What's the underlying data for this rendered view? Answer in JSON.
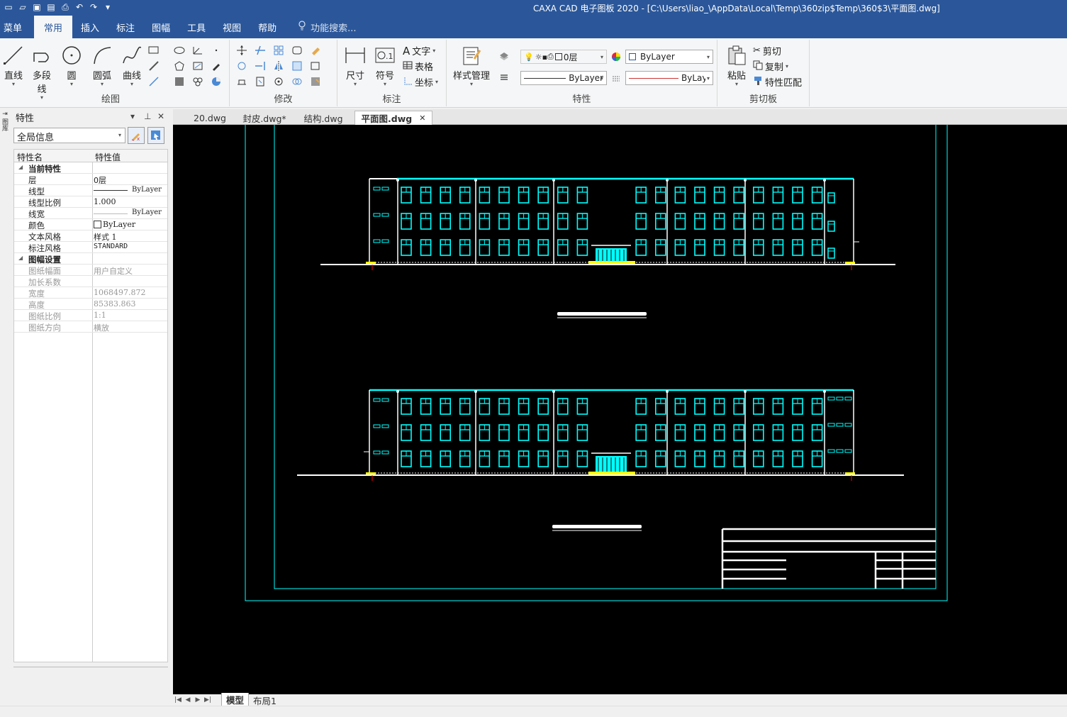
{
  "window": {
    "title": "CAXA CAD 电子图板 2020 - [C:\\Users\\liao_\\AppData\\Local\\Temp\\360zip$Temp\\360$3\\平面图.dwg]"
  },
  "ribbon": {
    "tabs": [
      {
        "label": "菜单"
      },
      {
        "label": "常用"
      },
      {
        "label": "插入"
      },
      {
        "label": "标注"
      },
      {
        "label": "图幅"
      },
      {
        "label": "工具"
      },
      {
        "label": "视图"
      },
      {
        "label": "帮助"
      }
    ],
    "active_tab": "常用",
    "search_placeholder": "功能搜索...",
    "groups": {
      "draw": {
        "label": "绘图",
        "line": "直线",
        "polyline": "多段线",
        "circle": "圆",
        "arc": "圆弧",
        "curve": "曲线"
      },
      "modify": {
        "label": "修改"
      },
      "annotate": {
        "label": "标注",
        "dimension": "尺寸",
        "symbol": "符号",
        "text": "文字",
        "table": "表格",
        "coord": "坐标"
      },
      "props": {
        "label": "特性",
        "style_mgr": "样式管理",
        "layer": "0层",
        "color": "ByLayer",
        "linetype": "ByLayer",
        "linewidth": "ByLayer"
      },
      "clipboard": {
        "label": "剪切板",
        "paste": "粘贴",
        "cut": "剪切",
        "copy": "复制",
        "match": "特性匹配"
      }
    }
  },
  "left_strip": {
    "text": "图库"
  },
  "prop_panel": {
    "title": "特性",
    "scope": "全局信息",
    "col_name": "特性名",
    "col_value": "特性值",
    "current_cat": "当前特性",
    "rows_current": [
      {
        "name": "层",
        "value": "0层"
      },
      {
        "name": "线型",
        "value": "ByLayer"
      },
      {
        "name": "线型比例",
        "value": "1.000"
      },
      {
        "name": "线宽",
        "value": "ByLayer"
      },
      {
        "name": "颜色",
        "value": "ByLayer"
      },
      {
        "name": "文本风格",
        "value": "样式 1"
      },
      {
        "name": "标注风格",
        "value": "STANDARD"
      }
    ],
    "sheet_cat": "图幅设置",
    "rows_sheet": [
      {
        "name": "图纸幅面",
        "value": "用户自定义"
      },
      {
        "name": "加长系数",
        "value": ""
      },
      {
        "name": "宽度",
        "value": "1068497.872"
      },
      {
        "name": "高度",
        "value": "85383.863"
      },
      {
        "name": "图纸比例",
        "value": "1:1"
      },
      {
        "name": "图纸方向",
        "value": "横放"
      }
    ]
  },
  "doc_tabs": [
    {
      "label": "20.dwg"
    },
    {
      "label": "封皮.dwg*"
    },
    {
      "label": "结构.dwg"
    },
    {
      "label": "平面图.dwg"
    }
  ],
  "active_doc": "平面图.dwg",
  "layout_tabs": [
    {
      "label": "模型"
    },
    {
      "label": "布局1"
    }
  ],
  "colors": {
    "accent": "#2b579a",
    "cad_cyan": "#00ffff",
    "cad_bg": "#000000",
    "cad_yellow": "#ffff00",
    "cad_red": "#ff0000"
  }
}
